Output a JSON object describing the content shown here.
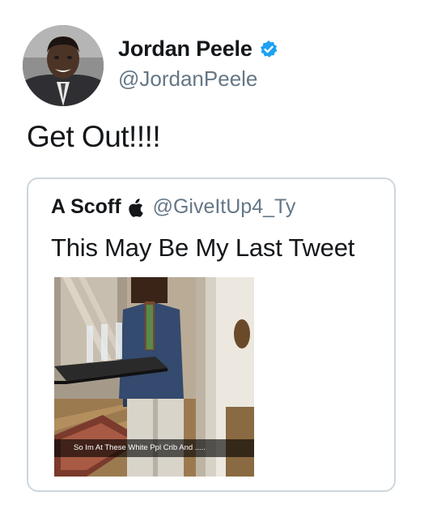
{
  "tweet": {
    "author": {
      "display_name": "Jordan Peele",
      "handle": "@JordanPeele",
      "verified": true,
      "verified_icon": "verified-badge-icon",
      "verified_color": "#1da1f2"
    },
    "text": "Get Out!!!!"
  },
  "quoted_tweet": {
    "author": {
      "display_name": "A Scoff",
      "name_emoji_icon": "apple-logo-icon",
      "handle": "@GiveItUp4_Ty"
    },
    "text": "This May Be My Last Tweet",
    "media": {
      "type": "photo",
      "caption": "So Im At These White Ppl Crib And ....."
    }
  },
  "colors": {
    "text": "#14171a",
    "secondary_text": "#657786",
    "border": "#ccd6dd",
    "verified": "#1da1f2"
  }
}
